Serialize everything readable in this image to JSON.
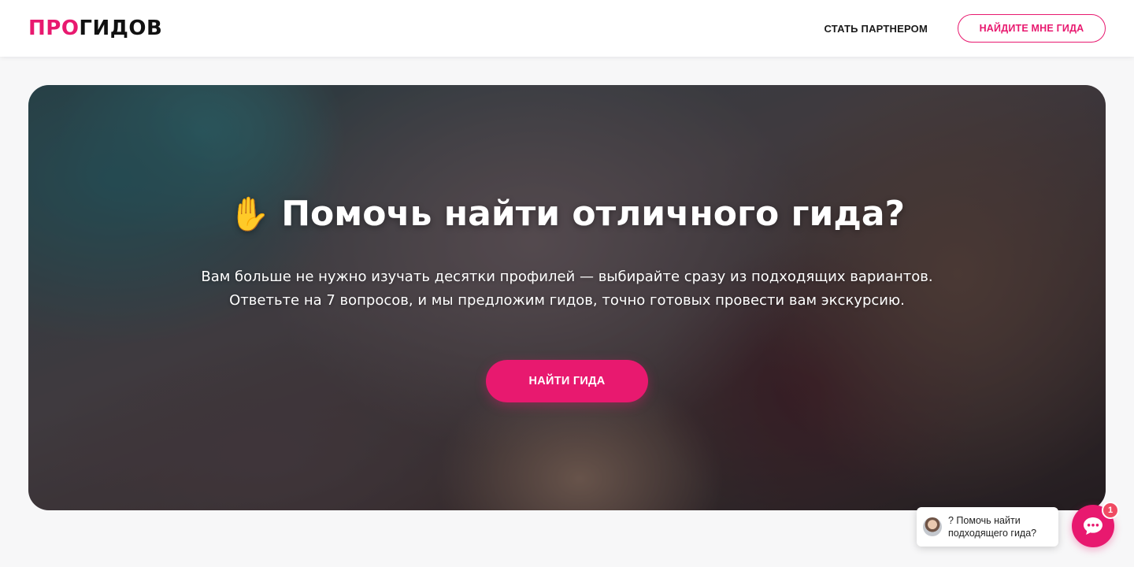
{
  "header": {
    "logo_pro": "ПРО",
    "logo_gidov": "ГИДОВ",
    "partner_link": "СТАТЬ ПАРТНЕРОМ",
    "find_guide_button": "НАЙДИТЕ МНЕ ГИДА"
  },
  "hero": {
    "icon": "raised-hand-emoji",
    "title": "Помочь найти отличного гида?",
    "subtitle_line1": "Вам больше не нужно изучать десятки профилей — выбирайте сразу из подходящих вариантов.",
    "subtitle_line2": "Ответьте на 7 вопросов, и мы предложим гидов, точно готовых провести вам экскурсию.",
    "cta": "НАЙТИ ГИДА"
  },
  "chat": {
    "message": "? Помочь найти подходящего гида?",
    "unread_count": "1"
  },
  "colors": {
    "accent": "#e8196f",
    "badge": "#f04b63"
  }
}
